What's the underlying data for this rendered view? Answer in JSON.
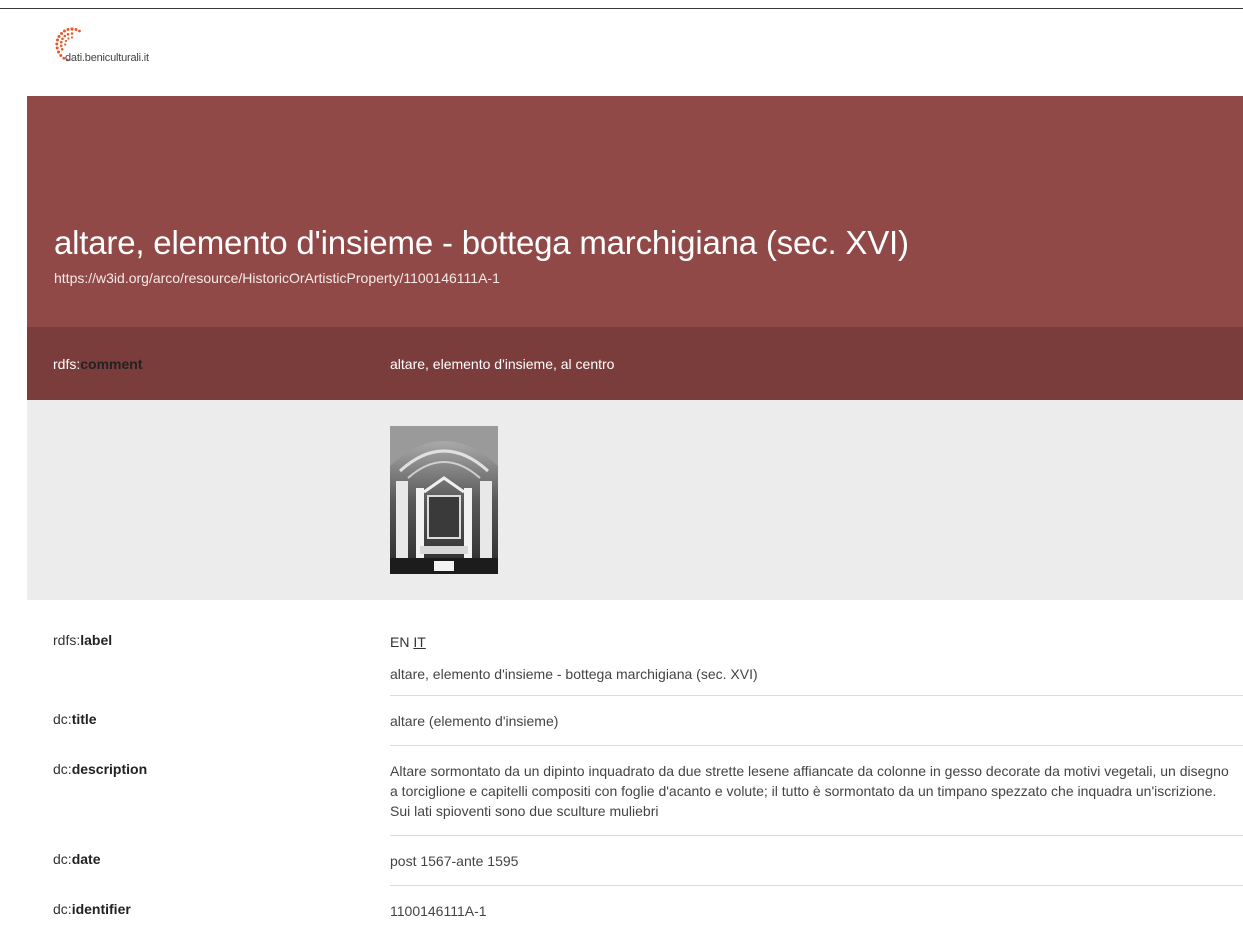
{
  "brand": {
    "logo_text": "dati.beniculturali.it"
  },
  "hero": {
    "title": "altare, elemento d'insieme - bottega marchigiana (sec. XVI)",
    "uri": "https://w3id.org/arco/resource/HistoricOrArtisticProperty/1100146111A-1"
  },
  "comment": {
    "prefix": "rdfs:",
    "name": "comment",
    "value": "altare, elemento d'insieme, al centro"
  },
  "properties": {
    "label": {
      "prefix": "rdfs:",
      "name": "label",
      "lang_en": "EN",
      "lang_it": "IT",
      "value": "altare, elemento d'insieme - bottega marchigiana (sec. XVI)"
    },
    "title": {
      "prefix": "dc:",
      "name": "title",
      "value": "altare (elemento d'insieme)"
    },
    "description": {
      "prefix": "dc:",
      "name": "description",
      "value": "Altare sormontato da un dipinto inquadrato da due strette lesene affiancate da colonne in gesso decorate da motivi vegetali, un disegno a torciglione e capitelli compositi con foglie d'acanto e volute; il tutto è sormontato da un timpano spezzato che inquadra un'iscrizione. Sui lati spioventi sono due sculture muliebri"
    },
    "date": {
      "prefix": "dc:",
      "name": "date",
      "value": "post 1567-ante 1595"
    },
    "identifier": {
      "prefix": "dc:",
      "name": "identifier",
      "value": "1100146111A-1"
    }
  },
  "colors": {
    "hero": "#914948",
    "comment_band": "#7b3c3c",
    "image_band": "#ececec"
  }
}
